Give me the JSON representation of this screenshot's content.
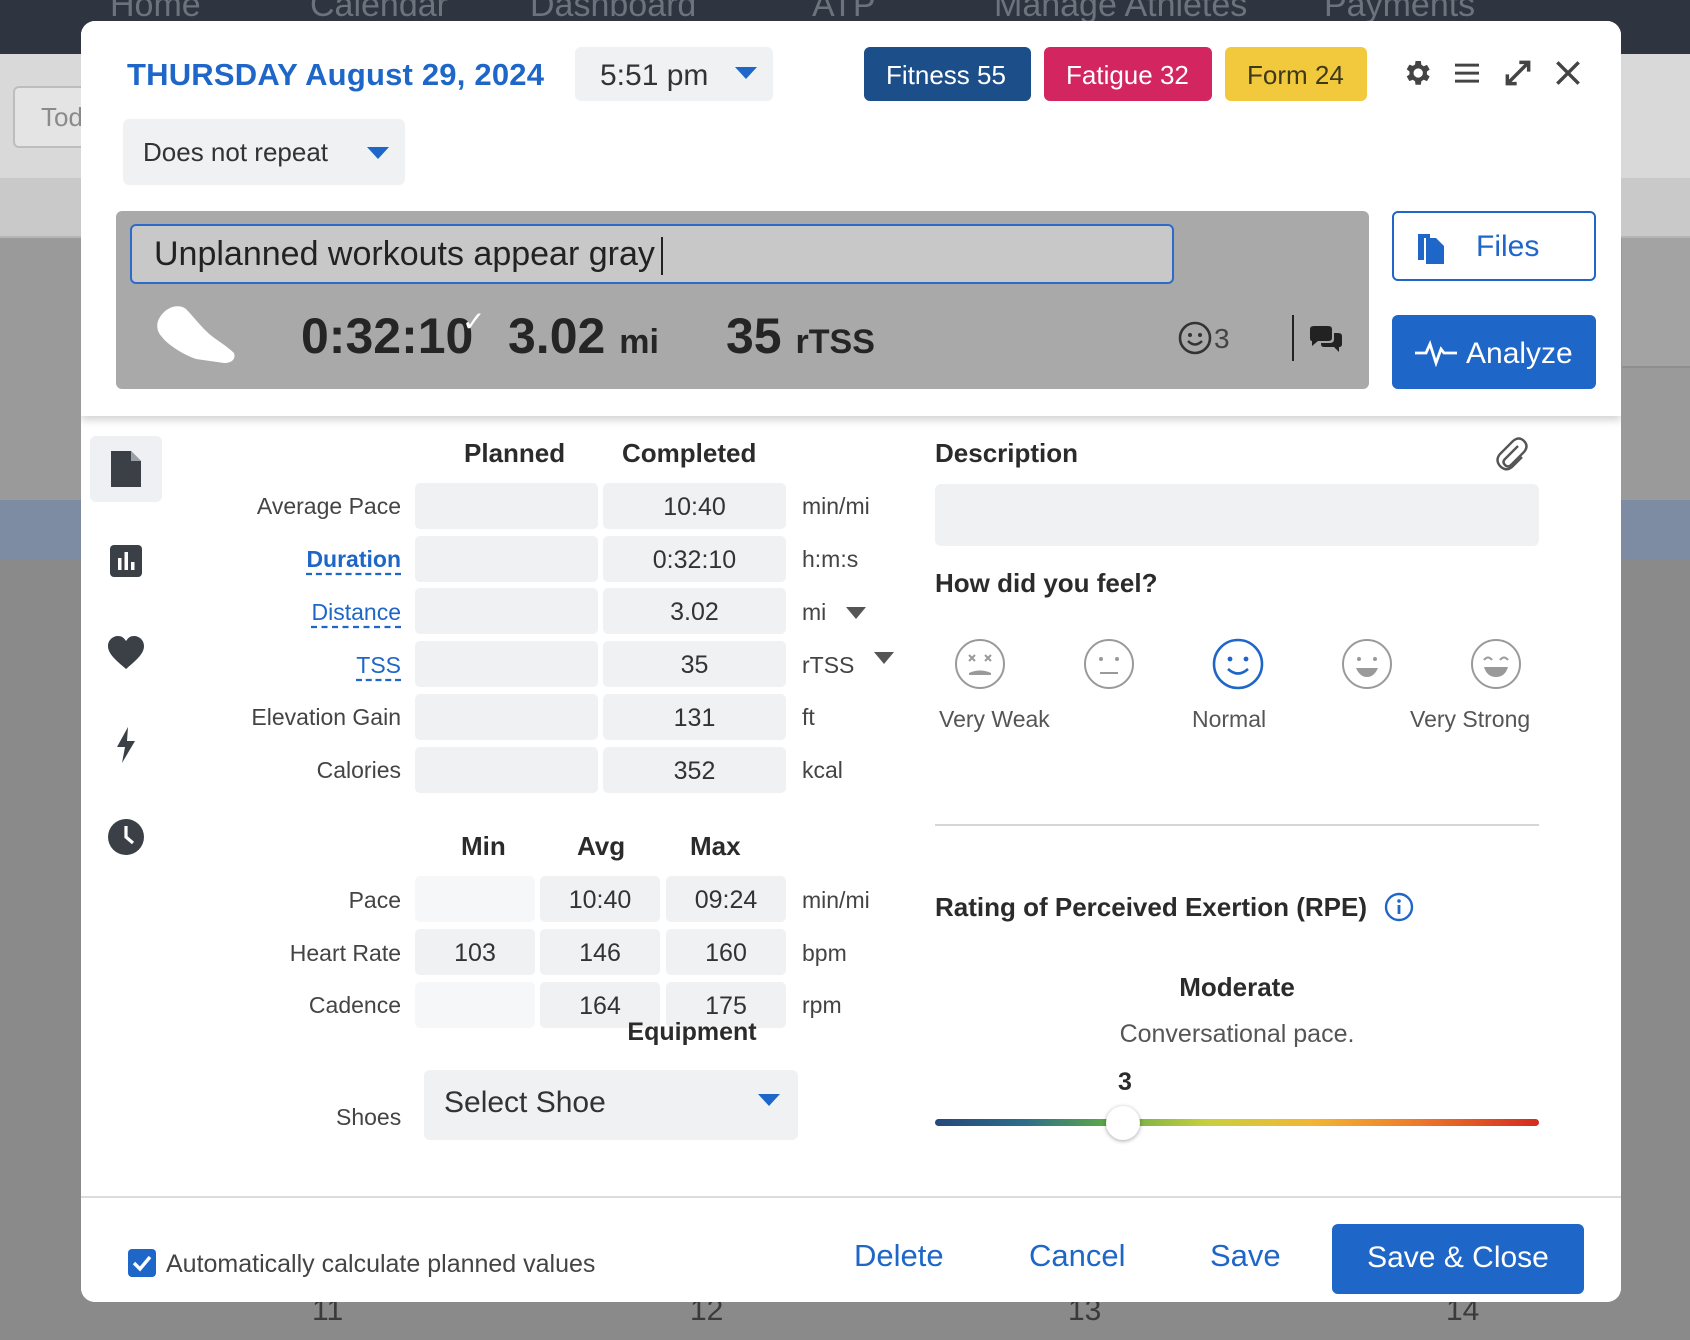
{
  "background": {
    "nav": [
      "Home",
      "Calendar",
      "Dashboard",
      "ATP",
      "Manage Athletes",
      "Payments"
    ],
    "today_button": "Tod",
    "day_numbers": [
      "11",
      "12",
      "13",
      "14"
    ]
  },
  "header": {
    "weekday": "THURSDAY",
    "date": "August 29, 2024",
    "time": "5:51 pm",
    "repeat": "Does not repeat",
    "fitness": "Fitness 55",
    "fatigue": "Fatigue 32",
    "form": "Form 24",
    "colors": {
      "fitness": "#1c4e8a",
      "fatigue": "#d3255f",
      "form": "#f2c83c",
      "accent": "#1e66c8"
    },
    "icons": [
      "gear-icon",
      "menu-icon",
      "expand-icon",
      "close-icon"
    ]
  },
  "workout": {
    "title": "Unplanned workouts appear gray",
    "duration": "0:32:10",
    "distance_value": "3.02",
    "distance_unit": "mi",
    "tss_value": "35",
    "tss_unit": "rTSS",
    "feel_count": "3",
    "files_label": "Files",
    "analyze_label": "Analyze"
  },
  "summary": {
    "planned_header": "Planned",
    "completed_header": "Completed",
    "rows": [
      {
        "label": "Average Pace",
        "planned": "",
        "completed": "10:40",
        "unit": "min/mi"
      },
      {
        "label": "Duration",
        "planned": "",
        "completed": "0:32:10",
        "unit": "h:m:s"
      },
      {
        "label": "Distance",
        "planned": "",
        "completed": "3.02",
        "unit": "mi"
      },
      {
        "label": "TSS",
        "planned": "",
        "completed": "35",
        "unit": "rTSS"
      },
      {
        "label": "Elevation Gain",
        "planned": "",
        "completed": "131",
        "unit": "ft"
      },
      {
        "label": "Calories",
        "planned": "",
        "completed": "352",
        "unit": "kcal"
      }
    ]
  },
  "ranges": {
    "min_header": "Min",
    "avg_header": "Avg",
    "max_header": "Max",
    "rows": [
      {
        "label": "Pace",
        "min": "",
        "avg": "10:40",
        "max": "09:24",
        "unit": "min/mi"
      },
      {
        "label": "Heart Rate",
        "min": "103",
        "avg": "146",
        "max": "160",
        "unit": "bpm"
      },
      {
        "label": "Cadence",
        "min": "",
        "avg": "164",
        "max": "175",
        "unit": "rpm"
      }
    ]
  },
  "equipment": {
    "title": "Equipment",
    "shoes_label": "Shoes",
    "shoe_select": "Select Shoe"
  },
  "description": {
    "title": "Description",
    "value": ""
  },
  "feel": {
    "title": "How did you feel?",
    "labels": [
      "Very Weak",
      "Normal",
      "Very Strong"
    ],
    "selected_index": 2
  },
  "rpe": {
    "title": "Rating of Perceived Exertion (RPE)",
    "level": "Moderate",
    "description": "Conversational pace.",
    "value": "3",
    "slider_fraction": 0.29
  },
  "footer": {
    "auto_calc_label": "Automatically calculate planned values",
    "auto_calc_checked": true,
    "delete_label": "Delete",
    "cancel_label": "Cancel",
    "save_label": "Save",
    "save_close_label": "Save & Close"
  }
}
